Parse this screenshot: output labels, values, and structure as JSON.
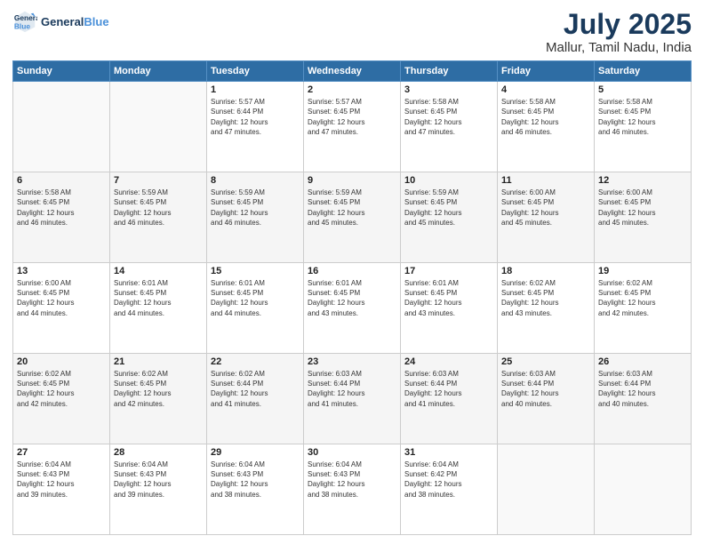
{
  "header": {
    "logo_line1": "General",
    "logo_line2": "Blue",
    "month": "July 2025",
    "location": "Mallur, Tamil Nadu, India"
  },
  "weekdays": [
    "Sunday",
    "Monday",
    "Tuesday",
    "Wednesday",
    "Thursday",
    "Friday",
    "Saturday"
  ],
  "weeks": [
    [
      {
        "day": "",
        "info": ""
      },
      {
        "day": "",
        "info": ""
      },
      {
        "day": "1",
        "info": "Sunrise: 5:57 AM\nSunset: 6:44 PM\nDaylight: 12 hours\nand 47 minutes."
      },
      {
        "day": "2",
        "info": "Sunrise: 5:57 AM\nSunset: 6:45 PM\nDaylight: 12 hours\nand 47 minutes."
      },
      {
        "day": "3",
        "info": "Sunrise: 5:58 AM\nSunset: 6:45 PM\nDaylight: 12 hours\nand 47 minutes."
      },
      {
        "day": "4",
        "info": "Sunrise: 5:58 AM\nSunset: 6:45 PM\nDaylight: 12 hours\nand 46 minutes."
      },
      {
        "day": "5",
        "info": "Sunrise: 5:58 AM\nSunset: 6:45 PM\nDaylight: 12 hours\nand 46 minutes."
      }
    ],
    [
      {
        "day": "6",
        "info": "Sunrise: 5:58 AM\nSunset: 6:45 PM\nDaylight: 12 hours\nand 46 minutes."
      },
      {
        "day": "7",
        "info": "Sunrise: 5:59 AM\nSunset: 6:45 PM\nDaylight: 12 hours\nand 46 minutes."
      },
      {
        "day": "8",
        "info": "Sunrise: 5:59 AM\nSunset: 6:45 PM\nDaylight: 12 hours\nand 46 minutes."
      },
      {
        "day": "9",
        "info": "Sunrise: 5:59 AM\nSunset: 6:45 PM\nDaylight: 12 hours\nand 45 minutes."
      },
      {
        "day": "10",
        "info": "Sunrise: 5:59 AM\nSunset: 6:45 PM\nDaylight: 12 hours\nand 45 minutes."
      },
      {
        "day": "11",
        "info": "Sunrise: 6:00 AM\nSunset: 6:45 PM\nDaylight: 12 hours\nand 45 minutes."
      },
      {
        "day": "12",
        "info": "Sunrise: 6:00 AM\nSunset: 6:45 PM\nDaylight: 12 hours\nand 45 minutes."
      }
    ],
    [
      {
        "day": "13",
        "info": "Sunrise: 6:00 AM\nSunset: 6:45 PM\nDaylight: 12 hours\nand 44 minutes."
      },
      {
        "day": "14",
        "info": "Sunrise: 6:01 AM\nSunset: 6:45 PM\nDaylight: 12 hours\nand 44 minutes."
      },
      {
        "day": "15",
        "info": "Sunrise: 6:01 AM\nSunset: 6:45 PM\nDaylight: 12 hours\nand 44 minutes."
      },
      {
        "day": "16",
        "info": "Sunrise: 6:01 AM\nSunset: 6:45 PM\nDaylight: 12 hours\nand 43 minutes."
      },
      {
        "day": "17",
        "info": "Sunrise: 6:01 AM\nSunset: 6:45 PM\nDaylight: 12 hours\nand 43 minutes."
      },
      {
        "day": "18",
        "info": "Sunrise: 6:02 AM\nSunset: 6:45 PM\nDaylight: 12 hours\nand 43 minutes."
      },
      {
        "day": "19",
        "info": "Sunrise: 6:02 AM\nSunset: 6:45 PM\nDaylight: 12 hours\nand 42 minutes."
      }
    ],
    [
      {
        "day": "20",
        "info": "Sunrise: 6:02 AM\nSunset: 6:45 PM\nDaylight: 12 hours\nand 42 minutes."
      },
      {
        "day": "21",
        "info": "Sunrise: 6:02 AM\nSunset: 6:45 PM\nDaylight: 12 hours\nand 42 minutes."
      },
      {
        "day": "22",
        "info": "Sunrise: 6:02 AM\nSunset: 6:44 PM\nDaylight: 12 hours\nand 41 minutes."
      },
      {
        "day": "23",
        "info": "Sunrise: 6:03 AM\nSunset: 6:44 PM\nDaylight: 12 hours\nand 41 minutes."
      },
      {
        "day": "24",
        "info": "Sunrise: 6:03 AM\nSunset: 6:44 PM\nDaylight: 12 hours\nand 41 minutes."
      },
      {
        "day": "25",
        "info": "Sunrise: 6:03 AM\nSunset: 6:44 PM\nDaylight: 12 hours\nand 40 minutes."
      },
      {
        "day": "26",
        "info": "Sunrise: 6:03 AM\nSunset: 6:44 PM\nDaylight: 12 hours\nand 40 minutes."
      }
    ],
    [
      {
        "day": "27",
        "info": "Sunrise: 6:04 AM\nSunset: 6:43 PM\nDaylight: 12 hours\nand 39 minutes."
      },
      {
        "day": "28",
        "info": "Sunrise: 6:04 AM\nSunset: 6:43 PM\nDaylight: 12 hours\nand 39 minutes."
      },
      {
        "day": "29",
        "info": "Sunrise: 6:04 AM\nSunset: 6:43 PM\nDaylight: 12 hours\nand 38 minutes."
      },
      {
        "day": "30",
        "info": "Sunrise: 6:04 AM\nSunset: 6:43 PM\nDaylight: 12 hours\nand 38 minutes."
      },
      {
        "day": "31",
        "info": "Sunrise: 6:04 AM\nSunset: 6:42 PM\nDaylight: 12 hours\nand 38 minutes."
      },
      {
        "day": "",
        "info": ""
      },
      {
        "day": "",
        "info": ""
      }
    ]
  ]
}
